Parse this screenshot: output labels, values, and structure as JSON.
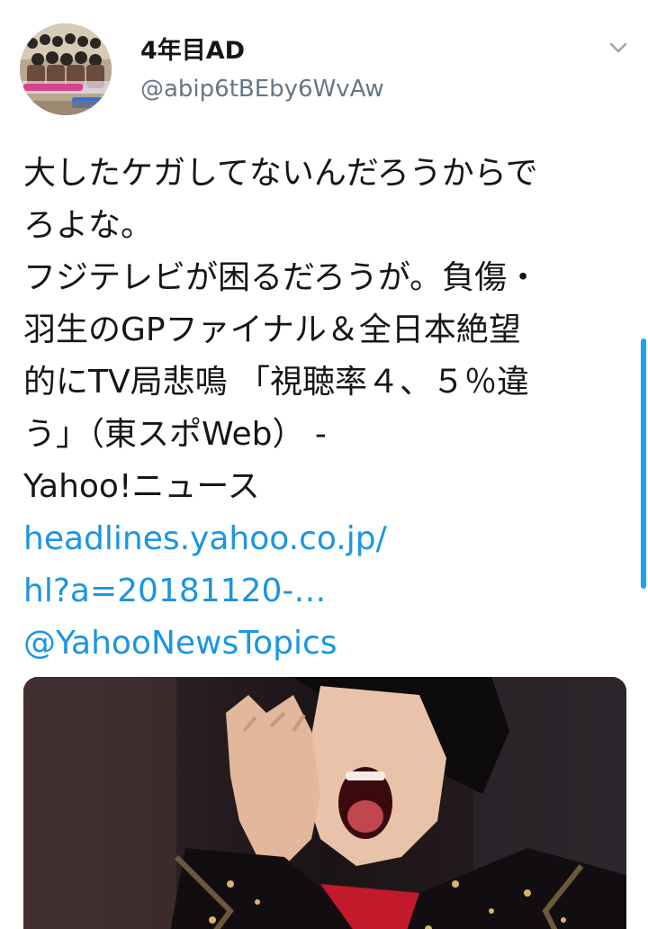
{
  "colors": {
    "accent": "#1da1f2",
    "link": "#1b95e0",
    "text": "#14171a",
    "secondary": "#657786"
  },
  "header": {
    "display_name": "4年目AD",
    "handle": "@abip6tBEby6WvAw",
    "avatar_icon": "group-photo-avatar",
    "menu_icon": "chevron-down-icon"
  },
  "tweet": {
    "lines": [
      "大したケガしてないんだろうからで",
      "ろよな。",
      "フジテレビが困るだろうが。負傷・",
      "羽生のGPファイナル＆全日本絶望",
      "的にTV局悲鳴 「視聴率４、５％違",
      "う」（東スポWeb） -",
      "Yahoo!ニュース"
    ],
    "link_lines": [
      "headlines.yahoo.co.jp/",
      "hl?a=20181120-…"
    ],
    "mention": "@YahooNewsTopics"
  },
  "media": {
    "icon": "photo-thumbnail"
  }
}
